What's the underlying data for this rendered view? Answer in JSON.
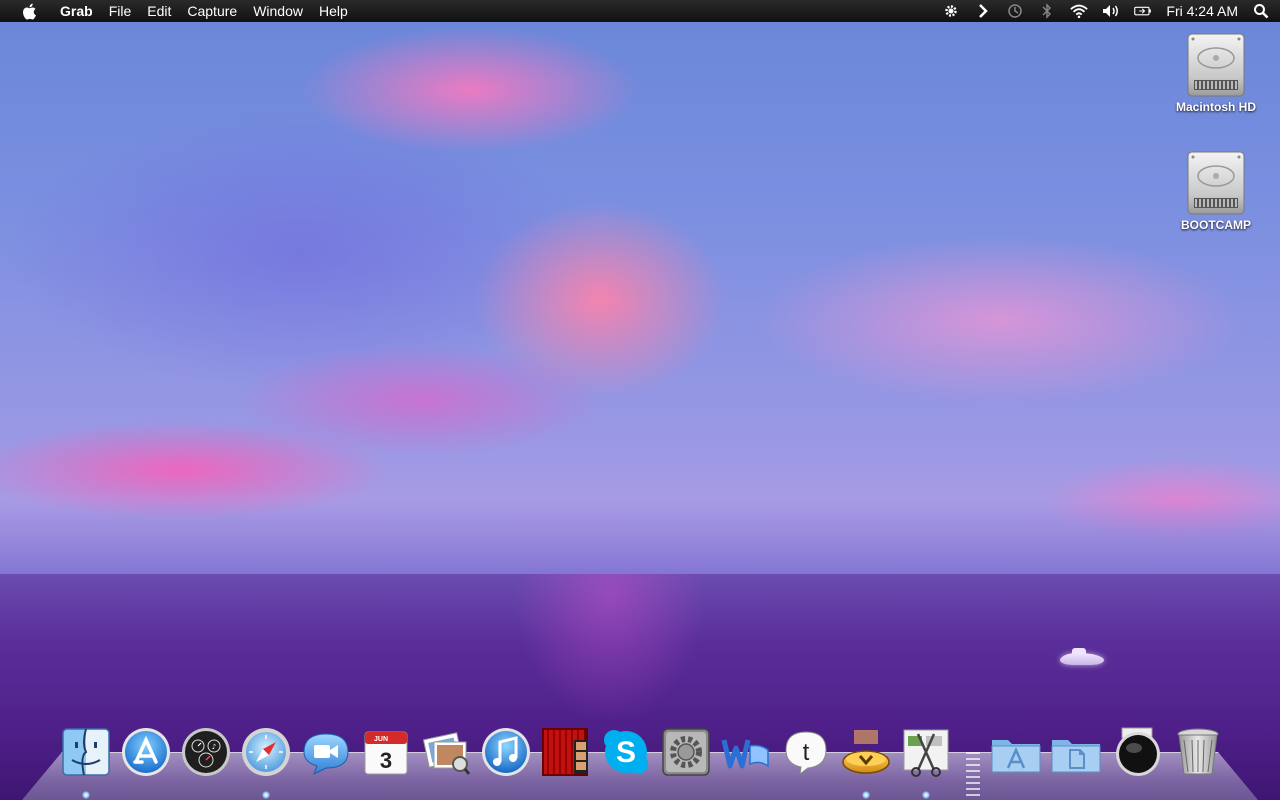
{
  "menubar": {
    "apple_icon": "apple-icon",
    "app_name": "Grab",
    "menus": [
      "File",
      "Edit",
      "Capture",
      "Window",
      "Help"
    ],
    "status_icons": [
      "gear-icon",
      "chevron-right-icon",
      "time-machine-icon",
      "bluetooth-icon",
      "wifi-icon",
      "volume-icon",
      "battery-icon"
    ],
    "clock": "Fri 4:24 AM",
    "spotlight_icon": "spotlight-search-icon"
  },
  "desktop": {
    "drives": [
      {
        "label": "Macintosh HD",
        "icon": "hard-drive-icon"
      },
      {
        "label": "BOOTCAMP",
        "icon": "hard-drive-icon"
      }
    ]
  },
  "dock": {
    "apps": [
      {
        "name": "Finder",
        "icon": "finder-icon",
        "running": true
      },
      {
        "name": "App Store",
        "icon": "app-store-icon",
        "running": false
      },
      {
        "name": "Dashboard",
        "icon": "dashboard-icon",
        "running": false
      },
      {
        "name": "Safari",
        "icon": "safari-icon",
        "running": true
      },
      {
        "name": "FaceTime",
        "icon": "facetime-icon",
        "running": false
      },
      {
        "name": "iCal",
        "icon": "calendar-icon",
        "running": false,
        "month": "JUN",
        "day": "3"
      },
      {
        "name": "Preview",
        "icon": "preview-icon",
        "running": false
      },
      {
        "name": "iTunes",
        "icon": "itunes-icon",
        "running": false
      },
      {
        "name": "Photo Booth",
        "icon": "photo-booth-icon",
        "running": false
      },
      {
        "name": "Skype",
        "icon": "skype-icon",
        "running": false
      },
      {
        "name": "System Preferences",
        "icon": "system-preferences-icon",
        "running": false
      },
      {
        "name": "Word",
        "icon": "word-icon",
        "running": false
      },
      {
        "name": "Tumblr",
        "icon": "tumblr-icon",
        "running": false
      },
      {
        "name": "Stacks",
        "icon": "stacks-icon",
        "running": true
      },
      {
        "name": "Grab",
        "icon": "grab-icon",
        "running": true
      }
    ],
    "folders": [
      {
        "name": "Applications",
        "icon": "applications-folder-icon"
      },
      {
        "name": "Documents",
        "icon": "documents-folder-icon"
      },
      {
        "name": "Downloads",
        "icon": "downloads-stack-icon"
      },
      {
        "name": "Trash",
        "icon": "trash-icon"
      }
    ]
  },
  "colors": {
    "menubar": "#1a1a1a",
    "sky": "#7a8fe0",
    "cloud_pink": "#ff78be",
    "sea": "#4e1f88",
    "running_indicator": "#9fd8ff"
  }
}
